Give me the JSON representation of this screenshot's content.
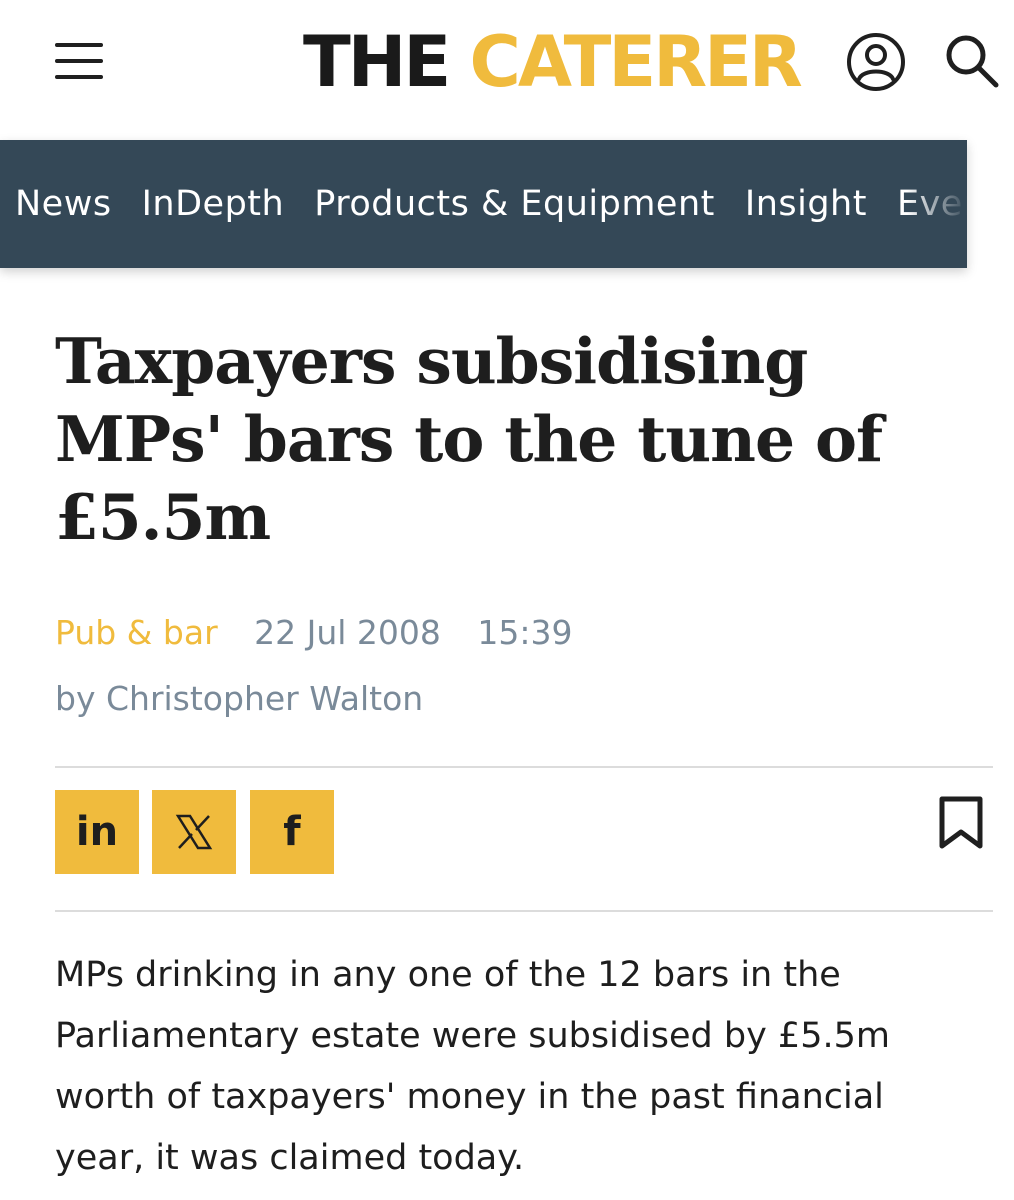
{
  "header": {
    "logo_the": "THE",
    "logo_caterer": "CATERER"
  },
  "nav": {
    "items": [
      "News",
      "InDepth",
      "Products & Equipment",
      "Insight",
      "Even"
    ]
  },
  "article": {
    "headline": "Taxpayers subsidising MPs' bars to the tune of £5.5m",
    "category": "Pub & bar",
    "date": "22 Jul 2008",
    "time": "15:39",
    "byline_prefix": "by",
    "author": "Christopher Walton",
    "body": "MPs drinking in any one of the 12 bars in the Parliamentary estate were subsidised by £5.5m worth of taxpayers' money in the past financial year, it was claimed today."
  },
  "share": {
    "linkedin_label": "in",
    "x_label": "𝕏",
    "facebook_label": "f"
  },
  "colors": {
    "brand_yellow": "#f0bb3d",
    "nav_background": "#344857",
    "meta_grey": "#7a8a99",
    "text_dark": "#1e1e1e"
  },
  "icons": [
    "menu-icon",
    "account-icon",
    "search-icon",
    "linkedin-icon",
    "x-icon",
    "facebook-icon",
    "bookmark-icon"
  ]
}
